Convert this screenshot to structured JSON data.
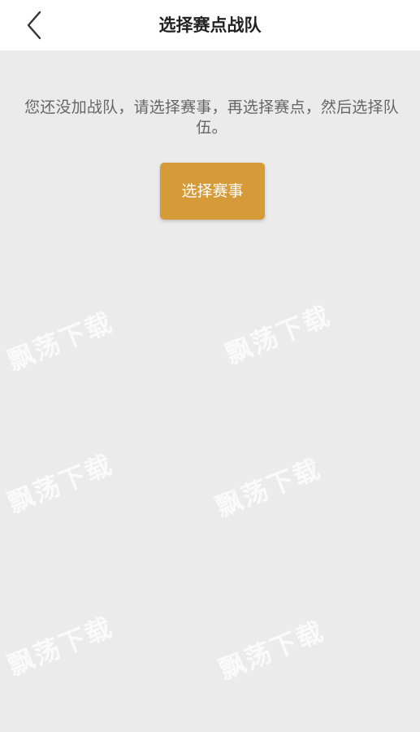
{
  "header": {
    "title": "选择赛点战队",
    "back_icon": "chevron-left-icon"
  },
  "main": {
    "hint": "您还没加战队，请选择赛事，再选择赛点，然后选择队伍。",
    "select_button_label": "选择赛事"
  },
  "watermark": {
    "text": "飘荡下载"
  },
  "colors": {
    "background": "#ebebeb",
    "header_background": "#ffffff",
    "accent": "#d69a38",
    "hint_text": "#666666",
    "title_text": "#222222"
  }
}
